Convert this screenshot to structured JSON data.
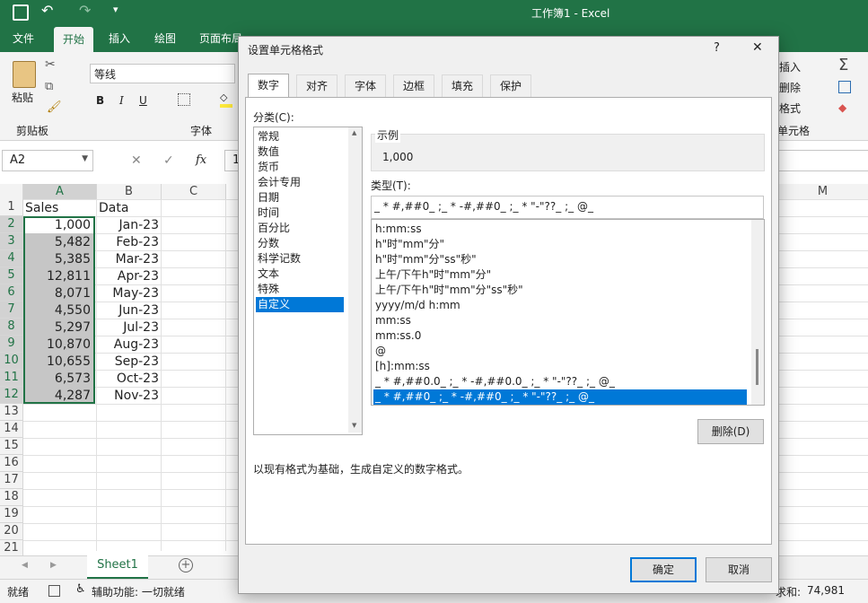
{
  "window": {
    "title": "工作簿1  -  Excel"
  },
  "ribbon": {
    "tabs": [
      "文件",
      "开始",
      "插入",
      "绘图",
      "页面布局"
    ],
    "active_tab": "开始",
    "clipboard": {
      "paste": "粘贴",
      "group": "剪贴板"
    },
    "font": {
      "name": "等线",
      "bold": "B",
      "italic": "I",
      "underline": "U",
      "group": "字体"
    },
    "cells": {
      "insert": "插入",
      "delete": "删除",
      "format": "格式",
      "group": "单元格"
    }
  },
  "formula_bar": {
    "name_box": "A2",
    "cancel": "✕",
    "enter": "✓",
    "fx": "fx",
    "formula": "1"
  },
  "sheet": {
    "columns": [
      "A",
      "B",
      "C",
      "M"
    ],
    "headers": {
      "a": "Sales",
      "b": "Data"
    },
    "rows": [
      "1",
      "2",
      "3",
      "4",
      "5",
      "6",
      "7",
      "8",
      "9",
      "10",
      "11",
      "12",
      "13",
      "14",
      "15",
      "16",
      "17",
      "18",
      "19",
      "20",
      "21"
    ],
    "data": [
      {
        "sales": "1,000",
        "date": "Jan-23"
      },
      {
        "sales": "5,482",
        "date": "Feb-23"
      },
      {
        "sales": "5,385",
        "date": "Mar-23"
      },
      {
        "sales": "12,811",
        "date": "Apr-23"
      },
      {
        "sales": "8,071",
        "date": "May-23"
      },
      {
        "sales": "4,550",
        "date": "Jun-23"
      },
      {
        "sales": "5,297",
        "date": "Jul-23"
      },
      {
        "sales": "10,870",
        "date": "Aug-23"
      },
      {
        "sales": "10,655",
        "date": "Sep-23"
      },
      {
        "sales": "6,573",
        "date": "Oct-23"
      },
      {
        "sales": "4,287",
        "date": "Nov-23"
      }
    ],
    "tab": "Sheet1"
  },
  "status": {
    "ready": "就绪",
    "accessibility": "辅助功能: 一切就绪",
    "sum_label": "求和:",
    "sum_value": "74,981"
  },
  "dialog": {
    "title": "设置单元格格式",
    "help": "?",
    "close": "✕",
    "tabs": [
      "数字",
      "对齐",
      "字体",
      "边框",
      "填充",
      "保护"
    ],
    "category_label": "分类(C):",
    "categories": [
      "常规",
      "数值",
      "货币",
      "会计专用",
      "日期",
      "时间",
      "百分比",
      "分数",
      "科学记数",
      "文本",
      "特殊",
      "自定义"
    ],
    "selected_category": "自定义",
    "sample_label": "示例",
    "sample_value": "1,000",
    "type_label": "类型(T):",
    "type_value": "_ * #,##0_ ;_ * -#,##0_ ;_ * \"-\"??_ ;_ @_",
    "formats": [
      "h:mm:ss",
      "h\"时\"mm\"分\"",
      "h\"时\"mm\"分\"ss\"秒\"",
      "上午/下午h\"时\"mm\"分\"",
      "上午/下午h\"时\"mm\"分\"ss\"秒\"",
      "yyyy/m/d h:mm",
      "mm:ss",
      "mm:ss.0",
      "@",
      "[h]:mm:ss",
      "_ * #,##0.0_ ;_ * -#,##0.0_ ;_ * \"-\"??_ ;_ @_",
      "_ * #,##0_ ;_ * -#,##0_ ;_ * \"-\"??_ ;_ @_"
    ],
    "delete_button": "删除(D)",
    "description": "以现有格式为基础，生成自定义的数字格式。",
    "ok_button": "确定",
    "cancel_button": "取消"
  },
  "colors": {
    "excel_green": "#217346",
    "selection_blue": "#0078d7"
  }
}
